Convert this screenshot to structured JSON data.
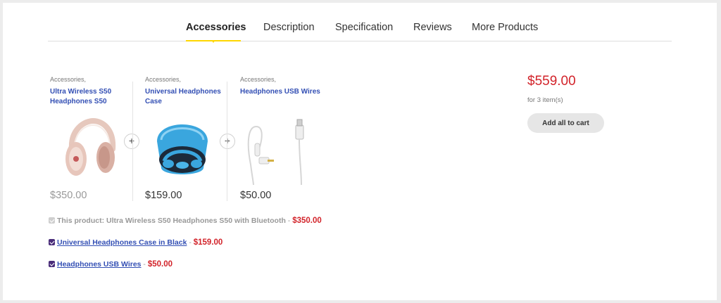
{
  "tabs": [
    {
      "label": "Accessories",
      "active": true
    },
    {
      "label": "Description",
      "active": false
    },
    {
      "label": "Specification",
      "active": false
    },
    {
      "label": "Reviews",
      "active": false
    },
    {
      "label": "More Products",
      "active": false
    }
  ],
  "products": [
    {
      "category": "Accessories,",
      "name": "Ultra Wireless S50 Headphones S50",
      "image": "headphones-image",
      "price": "$350.00"
    },
    {
      "category": "Accessories,",
      "name": "Universal Headphones Case",
      "image": "headphones-case-image",
      "price": "$159.00"
    },
    {
      "category": "Accessories,",
      "name": "Headphones USB Wires",
      "image": "usb-wires-image",
      "price": "$50.00"
    }
  ],
  "checklist": [
    {
      "checked": true,
      "disabled": true,
      "text": "This product: Ultra Wireless S50 Headphones S50 with Bluetooth",
      "separator": " - ",
      "price": "$350.00"
    },
    {
      "checked": true,
      "disabled": false,
      "text": "Universal Headphones Case in Black",
      "separator": " - ",
      "price": "$159.00"
    },
    {
      "checked": true,
      "disabled": false,
      "text": "Headphones USB Wires",
      "separator": " - ",
      "price": "$50.00"
    }
  ],
  "summary": {
    "total": "$559.00",
    "count": "for 3 item(s)",
    "button": "Add all to cart"
  },
  "colors": {
    "accent": "#fed700",
    "price": "#d2232a",
    "link": "#334fb4"
  },
  "plus_symbol": "+"
}
